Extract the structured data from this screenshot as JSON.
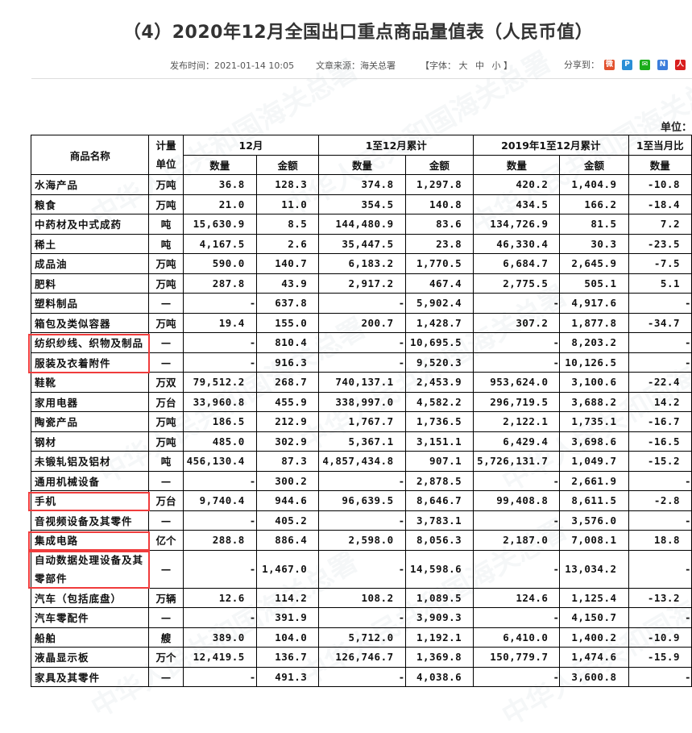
{
  "title": "（4）2020年12月全国出口重点商品量值表（人民币值）",
  "meta": {
    "publish_time": "发布时间：2021-01-14 10:05",
    "source": "文章来源：海关总署",
    "font_size_label": "【字体：",
    "font_large": "大",
    "font_medium": "中",
    "font_small": "小",
    "font_close": "】",
    "share_label": "分享到：",
    "share_icons": [
      {
        "name": "weibo-icon",
        "color": "#e2512e",
        "glyph": "微"
      },
      {
        "name": "qzone-icon",
        "color": "#2a8fd6",
        "glyph": "P"
      },
      {
        "name": "wechat-icon",
        "color": "#1aad19",
        "glyph": "✉"
      },
      {
        "name": "renren-icon",
        "color": "#3b7ddb",
        "glyph": "N"
      },
      {
        "name": "people-icon",
        "color": "#d81e1e",
        "glyph": "人"
      }
    ]
  },
  "unit_label": "单位：",
  "watermark": "中华人民共和国海关总署",
  "table": {
    "headers": {
      "name": "商品名称",
      "unit": "计量单位",
      "dec": "12月",
      "ytd": "1至12月累计",
      "prev_ytd": "2019年1至12月累计",
      "ratio": "1至当月比",
      "qty": "数量",
      "amount": "金额"
    },
    "rows": [
      {
        "name": "水海产品",
        "unit": "万吨",
        "dec_qty": "36.8",
        "dec_amt": "128.3",
        "ytd_qty": "374.8",
        "ytd_amt": "1,297.8",
        "prev_qty": "420.2",
        "prev_amt": "1,404.9",
        "ratio_qty": "-10.8"
      },
      {
        "name": "粮食",
        "unit": "万吨",
        "dec_qty": "21.0",
        "dec_amt": "11.0",
        "ytd_qty": "354.5",
        "ytd_amt": "140.8",
        "prev_qty": "434.5",
        "prev_amt": "166.2",
        "ratio_qty": "-18.4"
      },
      {
        "name": "中药材及中式成药",
        "unit": "吨",
        "dec_qty": "15,630.9",
        "dec_amt": "8.5",
        "ytd_qty": "144,480.9",
        "ytd_amt": "83.6",
        "prev_qty": "134,726.9",
        "prev_amt": "81.5",
        "ratio_qty": "7.2"
      },
      {
        "name": "稀土",
        "unit": "吨",
        "dec_qty": "4,167.5",
        "dec_amt": "2.6",
        "ytd_qty": "35,447.5",
        "ytd_amt": "23.8",
        "prev_qty": "46,330.4",
        "prev_amt": "30.3",
        "ratio_qty": "-23.5"
      },
      {
        "name": "成品油",
        "unit": "万吨",
        "dec_qty": "590.0",
        "dec_amt": "140.7",
        "ytd_qty": "6,183.2",
        "ytd_amt": "1,770.5",
        "prev_qty": "6,684.7",
        "prev_amt": "2,645.9",
        "ratio_qty": "-7.5"
      },
      {
        "name": "肥料",
        "unit": "万吨",
        "dec_qty": "287.8",
        "dec_amt": "43.9",
        "ytd_qty": "2,917.2",
        "ytd_amt": "467.4",
        "prev_qty": "2,775.5",
        "prev_amt": "505.1",
        "ratio_qty": "5.1"
      },
      {
        "name": "塑料制品",
        "unit": "—",
        "dec_qty": "-",
        "dec_amt": "637.8",
        "ytd_qty": "-",
        "ytd_amt": "5,902.4",
        "prev_qty": "-",
        "prev_amt": "4,917.6",
        "ratio_qty": "-"
      },
      {
        "name": "箱包及类似容器",
        "unit": "万吨",
        "dec_qty": "19.4",
        "dec_amt": "155.0",
        "ytd_qty": "200.7",
        "ytd_amt": "1,428.7",
        "prev_qty": "307.2",
        "prev_amt": "1,877.8",
        "ratio_qty": "-34.7"
      },
      {
        "name": "纺织纱线、织物及制品",
        "unit": "—",
        "dec_qty": "-",
        "dec_amt": "810.4",
        "ytd_qty": "-",
        "ytd_amt": "10,695.5",
        "prev_qty": "-",
        "prev_amt": "8,203.2",
        "ratio_qty": "-",
        "highlight": true
      },
      {
        "name": "服装及衣着附件",
        "unit": "—",
        "dec_qty": "-",
        "dec_amt": "916.3",
        "ytd_qty": "-",
        "ytd_amt": "9,520.3",
        "prev_qty": "-",
        "prev_amt": "10,126.5",
        "ratio_qty": "-",
        "highlight": true
      },
      {
        "name": "鞋靴",
        "unit": "万双",
        "dec_qty": "79,512.2",
        "dec_amt": "268.7",
        "ytd_qty": "740,137.1",
        "ytd_amt": "2,453.9",
        "prev_qty": "953,624.0",
        "prev_amt": "3,100.6",
        "ratio_qty": "-22.4"
      },
      {
        "name": "家用电器",
        "unit": "万台",
        "dec_qty": "33,960.8",
        "dec_amt": "455.9",
        "ytd_qty": "338,997.0",
        "ytd_amt": "4,582.2",
        "prev_qty": "296,719.5",
        "prev_amt": "3,688.2",
        "ratio_qty": "14.2"
      },
      {
        "name": "陶瓷产品",
        "unit": "万吨",
        "dec_qty": "186.5",
        "dec_amt": "212.9",
        "ytd_qty": "1,767.7",
        "ytd_amt": "1,736.5",
        "prev_qty": "2,122.1",
        "prev_amt": "1,735.1",
        "ratio_qty": "-16.7"
      },
      {
        "name": "钢材",
        "unit": "万吨",
        "dec_qty": "485.0",
        "dec_amt": "302.9",
        "ytd_qty": "5,367.1",
        "ytd_amt": "3,151.1",
        "prev_qty": "6,429.4",
        "prev_amt": "3,698.6",
        "ratio_qty": "-16.5"
      },
      {
        "name": "未锻轧铝及铝材",
        "unit": "吨",
        "dec_qty": "456,130.4",
        "dec_amt": "87.3",
        "ytd_qty": "4,857,434.8",
        "ytd_amt": "907.1",
        "prev_qty": "5,726,131.7",
        "prev_amt": "1,049.7",
        "ratio_qty": "-15.2"
      },
      {
        "name": "通用机械设备",
        "unit": "—",
        "dec_qty": "-",
        "dec_amt": "300.2",
        "ytd_qty": "-",
        "ytd_amt": "2,878.5",
        "prev_qty": "-",
        "prev_amt": "2,661.9",
        "ratio_qty": "-"
      },
      {
        "name": "手机",
        "unit": "万台",
        "dec_qty": "9,740.4",
        "dec_amt": "944.6",
        "ytd_qty": "96,639.5",
        "ytd_amt": "8,646.7",
        "prev_qty": "99,408.8",
        "prev_amt": "8,611.5",
        "ratio_qty": "-2.8",
        "highlight": true
      },
      {
        "name": "音视频设备及其零件",
        "unit": "—",
        "dec_qty": "-",
        "dec_amt": "405.2",
        "ytd_qty": "-",
        "ytd_amt": "3,783.1",
        "prev_qty": "-",
        "prev_amt": "3,576.0",
        "ratio_qty": "-"
      },
      {
        "name": "集成电路",
        "unit": "亿个",
        "dec_qty": "288.8",
        "dec_amt": "886.4",
        "ytd_qty": "2,598.0",
        "ytd_amt": "8,056.3",
        "prev_qty": "2,187.0",
        "prev_amt": "7,008.1",
        "ratio_qty": "18.8",
        "highlight": true
      },
      {
        "name": "自动数据处理设备及其零部件",
        "unit": "—",
        "dec_qty": "-",
        "dec_amt": "1,467.0",
        "ytd_qty": "-",
        "ytd_amt": "14,598.6",
        "prev_qty": "-",
        "prev_amt": "13,034.2",
        "ratio_qty": "-",
        "highlight": true,
        "tall": true
      },
      {
        "name": "汽车（包括底盘）",
        "unit": "万辆",
        "dec_qty": "12.6",
        "dec_amt": "114.2",
        "ytd_qty": "108.2",
        "ytd_amt": "1,089.5",
        "prev_qty": "124.6",
        "prev_amt": "1,125.4",
        "ratio_qty": "-13.2"
      },
      {
        "name": "汽车零配件",
        "unit": "—",
        "dec_qty": "-",
        "dec_amt": "391.9",
        "ytd_qty": "-",
        "ytd_amt": "3,909.3",
        "prev_qty": "-",
        "prev_amt": "4,150.7",
        "ratio_qty": "-"
      },
      {
        "name": "船舶",
        "unit": "艘",
        "dec_qty": "389.0",
        "dec_amt": "104.0",
        "ytd_qty": "5,712.0",
        "ytd_amt": "1,192.1",
        "prev_qty": "6,410.0",
        "prev_amt": "1,400.2",
        "ratio_qty": "-10.9"
      },
      {
        "name": "液晶显示板",
        "unit": "万个",
        "dec_qty": "12,419.5",
        "dec_amt": "136.7",
        "ytd_qty": "126,746.7",
        "ytd_amt": "1,369.8",
        "prev_qty": "150,779.7",
        "prev_amt": "1,474.6",
        "ratio_qty": "-15.9"
      },
      {
        "name": "家具及其零件",
        "unit": "—",
        "dec_qty": "-",
        "dec_amt": "491.3",
        "ytd_qty": "-",
        "ytd_amt": "4,038.6",
        "prev_qty": "-",
        "prev_amt": "3,600.8",
        "ratio_qty": "-"
      }
    ]
  },
  "highlight_color": "#f03c3c"
}
